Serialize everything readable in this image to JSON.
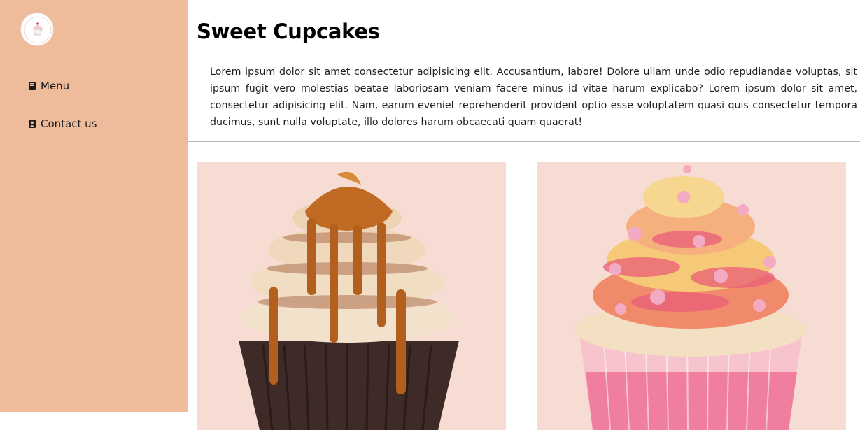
{
  "nav": {
    "items": [
      {
        "label": "Menu",
        "icon": "book-icon"
      },
      {
        "label": "Contact us",
        "icon": "contact-card-icon"
      }
    ]
  },
  "main": {
    "title": "Sweet Cupcakes",
    "intro": "Lorem ipsum dolor sit amet consectetur adipisicing elit. Accusantium, labore! Dolore ullam unde odio repudiandae voluptas, sit ipsum fugit vero molestias beatae laboriosam veniam facere minus id vitae harum explicabo? Lorem ipsum dolor sit amet, consectetur adipisicing elit. Nam, earum eveniet reprehenderit provident optio esse voluptatem quasi quis consectetur tempora ducimus, sunt nulla voluptate, illo dolores harum obcaecati quam quaerat!"
  },
  "colors": {
    "sidebar": "#eebb9b",
    "card_bg": "#f6dcd3",
    "divider": "#b9b9b9"
  },
  "gallery": [
    {
      "name": "caramel-cupcake"
    },
    {
      "name": "pink-sprinkle-cupcake"
    }
  ]
}
